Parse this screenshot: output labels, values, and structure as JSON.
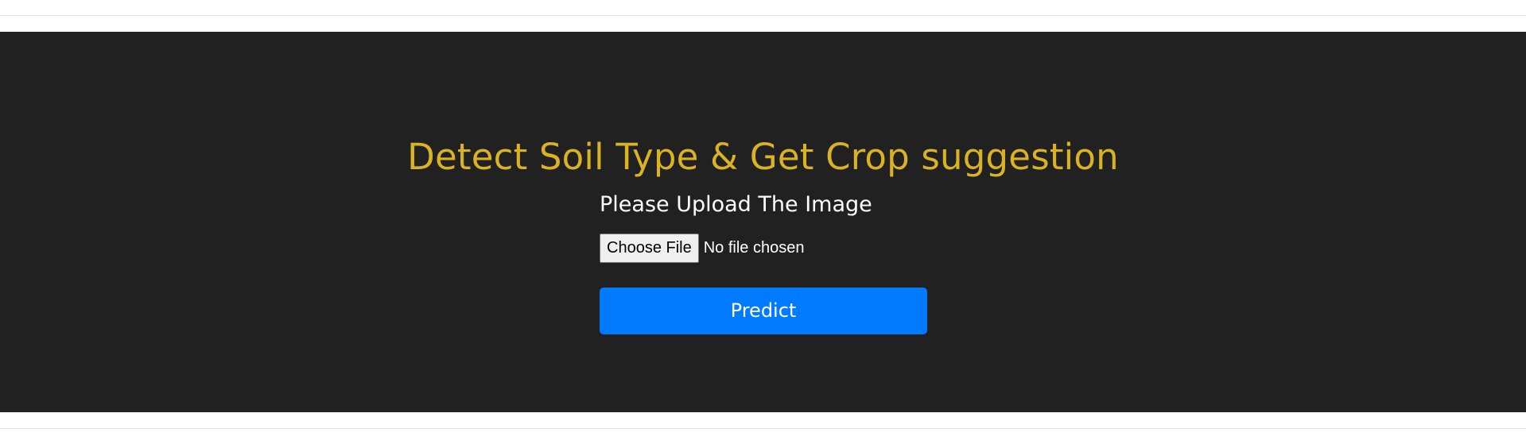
{
  "hero": {
    "title": "Detect Soil Type & Get Crop suggestion",
    "upload_label": "Please Upload The Image",
    "file_input": {
      "button_label": "Choose File",
      "status_text": "No file chosen"
    },
    "predict_label": "Predict"
  },
  "colors": {
    "hero_background": "#212121",
    "title": "#dbb223",
    "primary_button": "#007bff"
  }
}
